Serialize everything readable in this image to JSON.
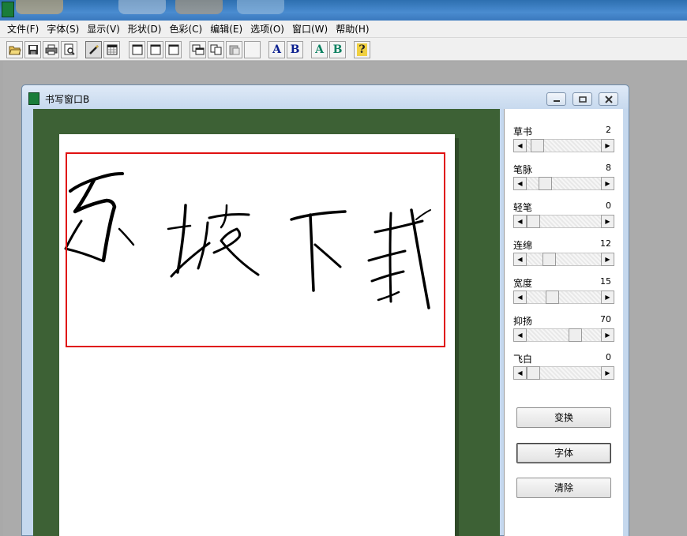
{
  "menu": [
    {
      "label": "文件(F)"
    },
    {
      "label": "字体(S)"
    },
    {
      "label": "显示(V)"
    },
    {
      "label": "形状(D)"
    },
    {
      "label": "色彩(C)"
    },
    {
      "label": "编辑(E)"
    },
    {
      "label": "选项(O)"
    },
    {
      "label": "窗口(W)"
    },
    {
      "label": "帮助(H)"
    }
  ],
  "toolbar": {
    "font_a_blue": "A",
    "font_b_blue": "B",
    "font_a_green": "A",
    "font_b_green": "B",
    "help": "?"
  },
  "window": {
    "title": "书写窗口B"
  },
  "params": [
    {
      "label": "草书",
      "value": "2",
      "level": 0.06
    },
    {
      "label": "笔脉",
      "value": "8",
      "level": 0.2
    },
    {
      "label": "轻笔",
      "value": "0",
      "level": 0.0
    },
    {
      "label": "连绵",
      "value": "12",
      "level": 0.26
    },
    {
      "label": "宽度",
      "value": "15",
      "level": 0.32
    },
    {
      "label": "抑扬",
      "value": "70",
      "level": 0.7
    },
    {
      "label": "飞白",
      "value": "0",
      "level": 0.0
    }
  ],
  "buttons": {
    "transform": "变换",
    "font": "字体",
    "clear": "清除"
  },
  "colors": {
    "canvas_green": "#3d6135",
    "selection_red": "#e01010",
    "font_blue": "#0a1f8f",
    "font_green": "#0a8060"
  }
}
